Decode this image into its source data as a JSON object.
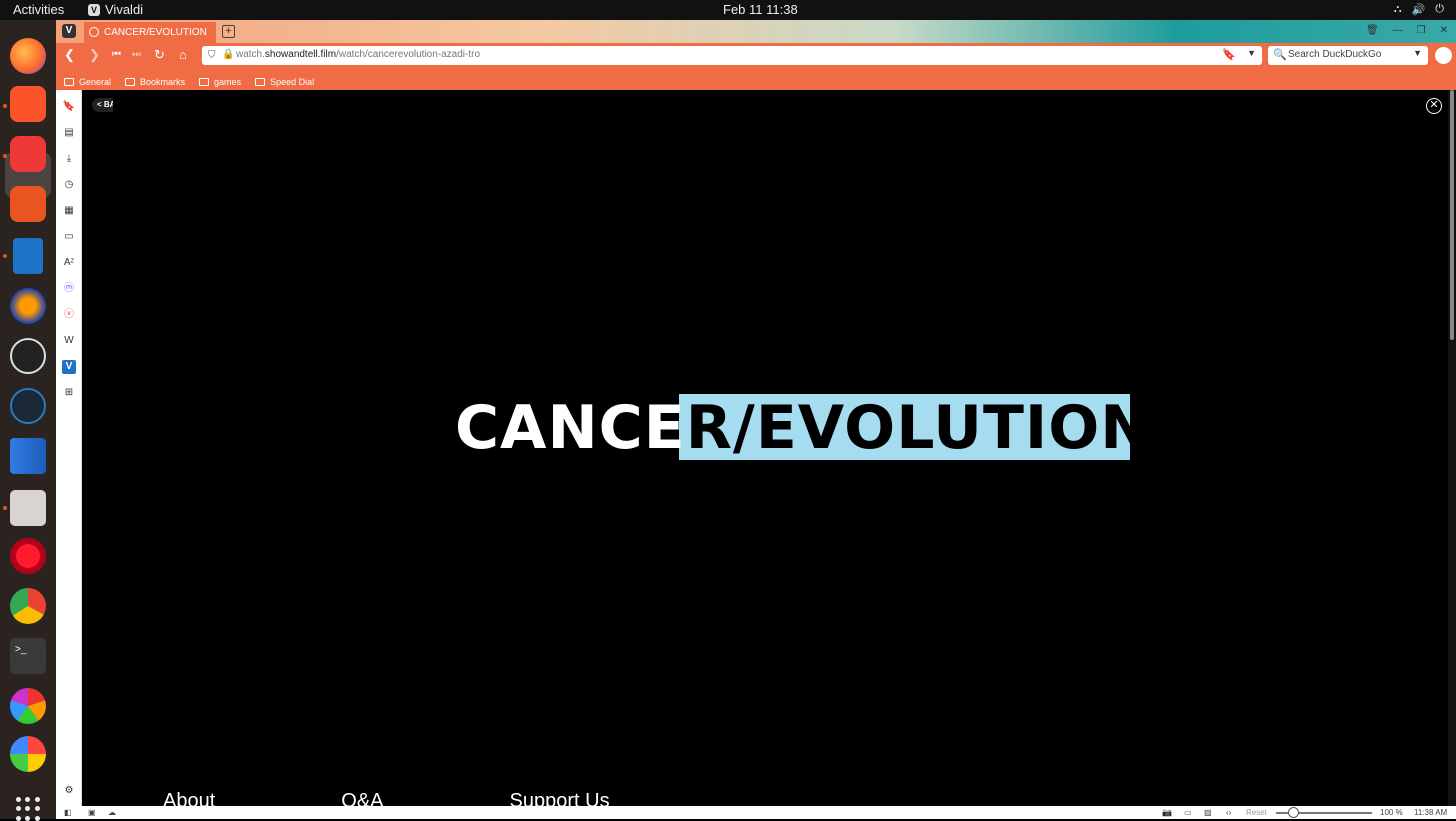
{
  "topbar": {
    "activities": "Activities",
    "app_name": "Vivaldi",
    "clock": "Feb 11  11:38"
  },
  "dock": {
    "apps": [
      "firefox-icon",
      "brave-icon",
      "vivaldi-icon",
      "app-center-icon",
      "writer-icon",
      "audacity-icon",
      "obs-icon",
      "steam-icon",
      "kdenlive-icon",
      "files-icon",
      "opera-icon",
      "chrome-icon",
      "terminal-icon",
      "darktable-icon",
      "photo-icon"
    ]
  },
  "browser": {
    "tab_title": "CANCER/EVOLUTION",
    "url_prefix": "watch.",
    "url_domain": "showandtell.film",
    "url_path": "/watch/cancerevolution-azadi-tro",
    "search_placeholder": "Search DuckDuckGo",
    "bookmarks": [
      "General",
      "Bookmarks",
      "games",
      "Speed Dial"
    ]
  },
  "content": {
    "back_label": "< BACK",
    "close_glyph": "✕",
    "title_part1": "CANCE",
    "title_part2": "R/EVOLUTION",
    "footer_links": [
      "About",
      "Q&A",
      "Support Us"
    ]
  },
  "statusbar": {
    "reset_label": "Reset",
    "zoom": "100 %",
    "time": "11:38 AM"
  },
  "colors": {
    "accent": "#ef6c45",
    "highlight": "#a6dcf0"
  }
}
